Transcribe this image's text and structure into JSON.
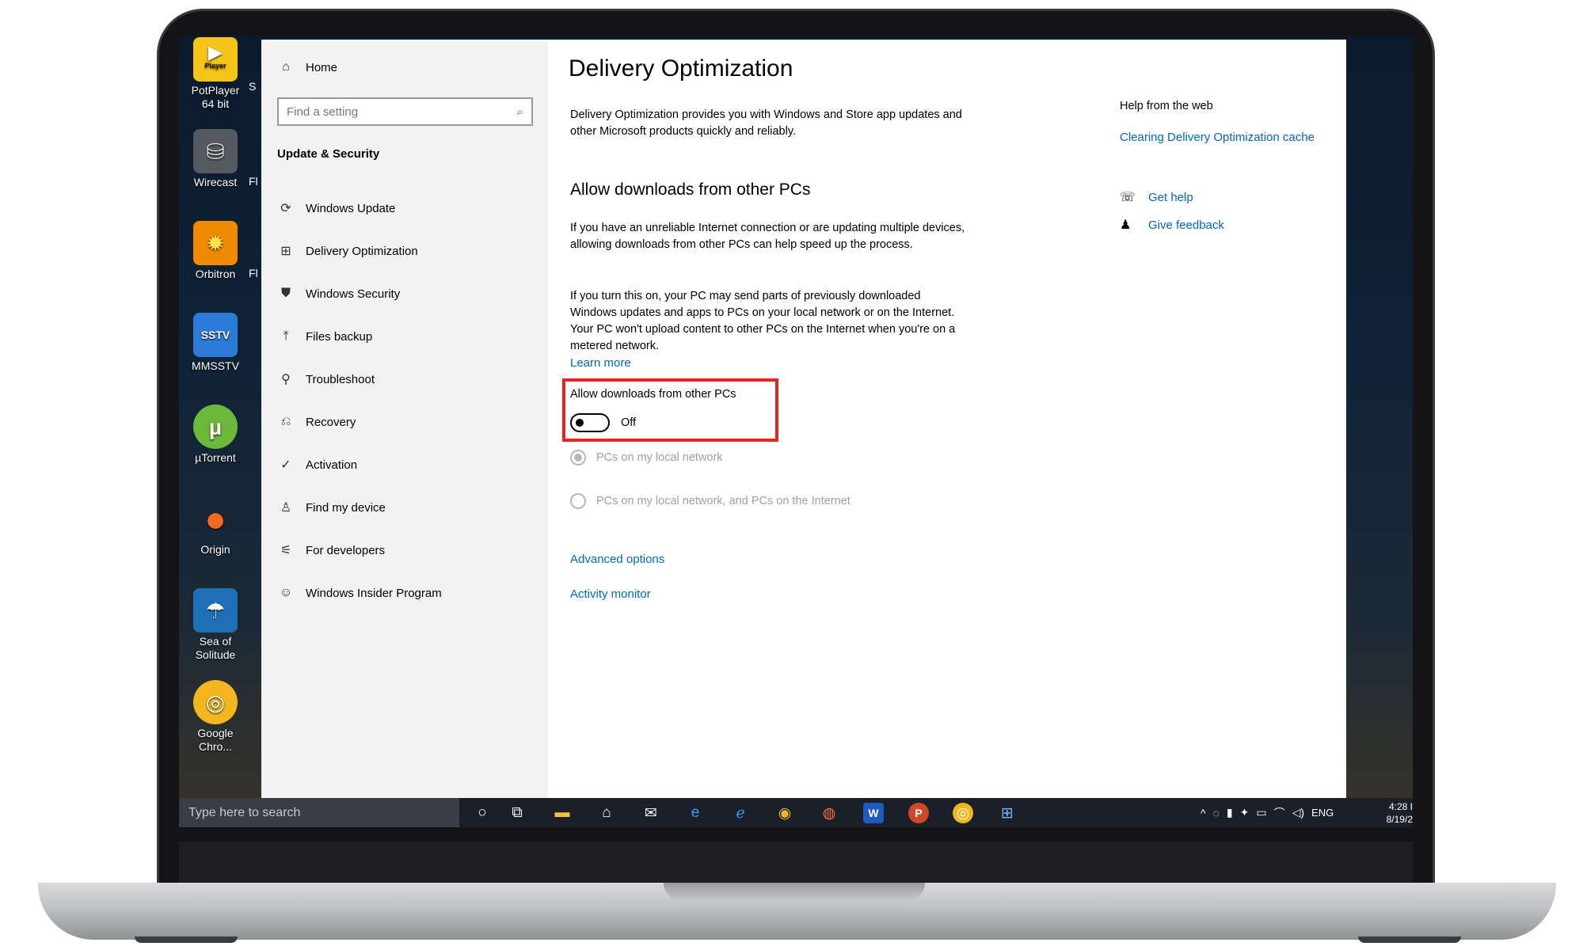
{
  "desktop": {
    "icons": [
      {
        "name": "PotPlayer 64 bit",
        "badge": "Player",
        "color": "#f5c518"
      },
      {
        "name": "Wirecast",
        "badge": "",
        "color": "#555a60"
      },
      {
        "name": "Orbitron",
        "badge": "",
        "color": "#f08a00"
      },
      {
        "name": "MMSSTV",
        "badge": "SSTV",
        "color": "#2c7bd6"
      },
      {
        "name": "µTorrent",
        "badge": "µ",
        "color": "#6bb83a"
      },
      {
        "name": "Origin",
        "badge": "",
        "color": "#f26b21"
      },
      {
        "name": "Sea of Solitude",
        "badge": "",
        "color": "#1e6fb5"
      },
      {
        "name": "Google Chro...",
        "badge": "",
        "color": "#f3b61f"
      }
    ],
    "partial_labels": [
      "S",
      "Fl",
      "Fl"
    ]
  },
  "settings": {
    "home_label": "Home",
    "search_placeholder": "Find a setting",
    "section_title": "Update & Security",
    "nav": [
      {
        "label": "Windows Update",
        "icon": "refresh-icon"
      },
      {
        "label": "Delivery Optimization",
        "icon": "delivery-icon"
      },
      {
        "label": "Windows Security",
        "icon": "shield-icon"
      },
      {
        "label": "Files backup",
        "icon": "upload-arrow-icon"
      },
      {
        "label": "Troubleshoot",
        "icon": "wrench-icon"
      },
      {
        "label": "Recovery",
        "icon": "recovery-icon"
      },
      {
        "label": "Activation",
        "icon": "check-circle-icon"
      },
      {
        "label": "Find my device",
        "icon": "person-location-icon"
      },
      {
        "label": "For developers",
        "icon": "sliders-icon"
      },
      {
        "label": "Windows Insider Program",
        "icon": "insider-cat-icon"
      }
    ],
    "page_title": "Delivery Optimization",
    "intro": "Delivery Optimization provides you with Windows and Store app updates and other Microsoft products quickly and reliably.",
    "section_heading": "Allow downloads from other PCs",
    "para1": "If you have an unreliable Internet connection or are updating multiple devices, allowing downloads from other PCs can help speed up the process.",
    "para2": "If you turn this on, your PC may send parts of previously downloaded Windows updates and apps to PCs on your local network or on the Internet. Your PC won't upload content to other PCs on the Internet when you're on a metered network.",
    "learn_more": "Learn more",
    "toggle_label": "Allow downloads from other PCs",
    "toggle_state": "Off",
    "radio1": "PCs on my local network",
    "radio2": "PCs on my local network, and PCs on the Internet",
    "advanced_options": "Advanced options",
    "activity_monitor": "Activity monitor",
    "help_title": "Help from the web",
    "help_link": "Clearing Delivery Optimization cache",
    "get_help": "Get help",
    "give_feedback": "Give feedback"
  },
  "taskbar": {
    "search_placeholder": "Type here to search",
    "apps": [
      "cortana-icon",
      "task-view-icon",
      "file-explorer-icon",
      "store-icon",
      "mail-icon",
      "edge-icon",
      "ie-icon",
      "chrome-icon",
      "firefox-icon",
      "word-icon",
      "powerpoint-icon",
      "chrome-canary-icon",
      "network-app-icon"
    ],
    "language": "ENG",
    "time": "4:28 I",
    "date": "8/19/2"
  },
  "colors": {
    "link": "#0067c0",
    "highlight": "#e3261f",
    "sidebar_bg": "#f2f2f2",
    "taskbar_bg": "#1b1f2a"
  }
}
